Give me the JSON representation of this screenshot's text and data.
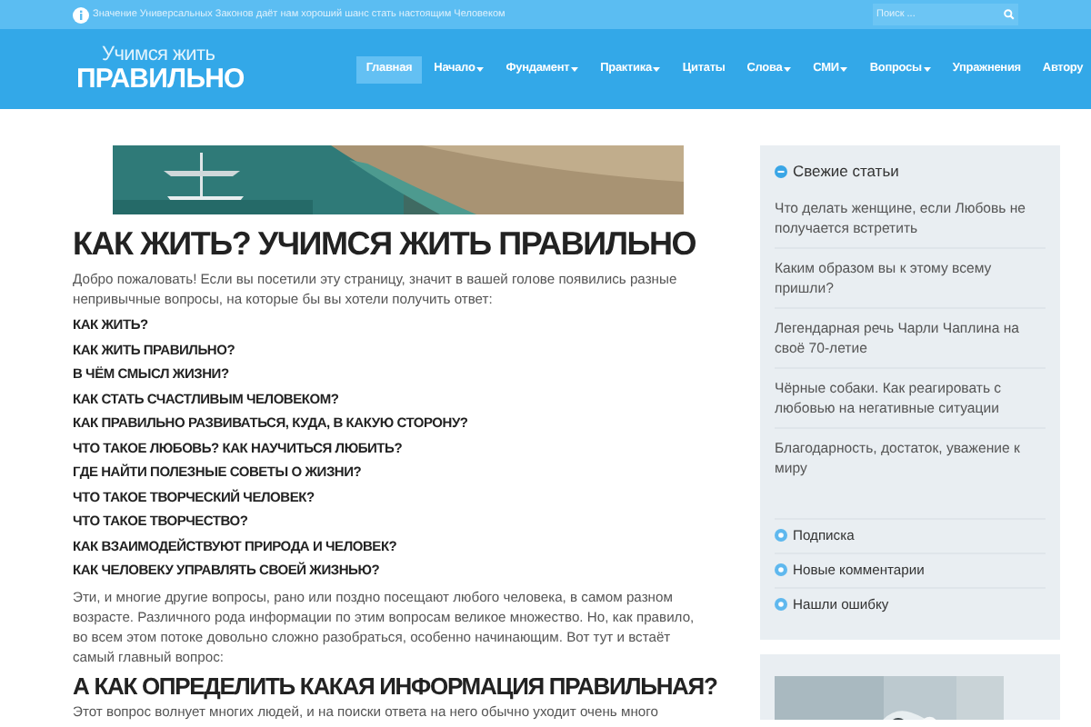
{
  "top_bar": {
    "notice": "Значение Универсальных Законов даёт нам хороший шанс стать настоящим Человеком",
    "search": {
      "placeholder": "Поиск ..."
    }
  },
  "logo": {
    "line_1": "Учимся жить",
    "line_2": "ПРАВИЛЬНО"
  },
  "nav": [
    {
      "label": "Главная",
      "selected": true,
      "dropdown": false
    },
    {
      "label": "Начало",
      "selected": false,
      "dropdown": true
    },
    {
      "label": "Фундамент",
      "selected": false,
      "dropdown": true
    },
    {
      "label": "Практика",
      "selected": false,
      "dropdown": true
    },
    {
      "label": "Цитаты",
      "selected": false,
      "dropdown": false
    },
    {
      "label": "Слова",
      "selected": false,
      "dropdown": true
    },
    {
      "label": "СМИ",
      "selected": false,
      "dropdown": true
    },
    {
      "label": "Вопросы",
      "selected": false,
      "dropdown": true
    },
    {
      "label": "Упражнения",
      "selected": false,
      "dropdown": false
    },
    {
      "label": "Автору",
      "selected": false,
      "dropdown": false
    }
  ],
  "main": {
    "title": "КАК ЖИТЬ? УЧИМСЯ ЖИТЬ ПРАВИЛЬНО",
    "intro": "Добро пожаловать! Если вы посетили эту страницу, значит в вашей голове появились разные непривычные вопросы, на которые бы вы хотели получить ответ:",
    "questions": [
      "КАК ЖИТЬ?",
      "КАК ЖИТЬ ПРАВИЛЬНО?",
      "В ЧЁМ СМЫСЛ ЖИЗНИ?",
      "КАК СТАТЬ СЧАСТЛИВЫМ ЧЕЛОВЕКОМ?",
      "КАК ПРАВИЛЬНО РАЗВИВАТЬСЯ, КУДА, В КАКУЮ СТОРОНУ?",
      "ЧТО ТАКОЕ ЛЮБОВЬ? КАК НАУЧИТЬСЯ ЛЮБИТЬ?",
      "ГДЕ НАЙТИ ПОЛЕЗНЫЕ СОВЕТЫ О ЖИЗНИ?",
      "ЧТО ТАКОЕ ТВОРЧЕСКИЙ ЧЕЛОВЕК?",
      "ЧТО ТАКОЕ ТВОРЧЕСТВО?",
      "КАК ВЗАИМОДЕЙСТВУЮТ ПРИРОДА И ЧЕЛОВЕК?",
      "КАК ЧЕЛОВЕКУ УПРАВЛЯТЬ СВОЕЙ ЖИЗНЬЮ?"
    ],
    "paragraph": "Эти, и многие другие вопросы, рано или поздно посещают любого человека, в самом разном возрасте. Различного рода информации по этим вопросам великое множество. Но, как правило, во всем этом потоке довольно сложно разобраться, особенно начинающим. Вот тут и встаёт самый главный вопрос:",
    "subtitle": "А КАК ОПРЕДЕЛИТЬ КАКАЯ ИНФОРМАЦИЯ ПРАВИЛЬНАЯ?",
    "last_line": "Этот вопрос волнует многих людей, и на поиски ответа на него обычно уходит очень много"
  },
  "sidebar": {
    "recent": {
      "title": "Свежие статьи",
      "expanded": true,
      "items": [
        "Что делать женщине, если Любовь не получается встретить",
        "Каким образом вы к этому всему пришли?",
        "Легендарная речь Чарли Чаплина на своё 70-летие",
        "Чёрные собаки. Как реагировать с любовью на негативные ситуации",
        "Благодарность, достаток, уважение к миру"
      ]
    },
    "links": [
      {
        "label": "Подписка",
        "expanded": false
      },
      {
        "label": "Новые комментарии",
        "expanded": false
      },
      {
        "label": "Нашли ошибку",
        "expanded": false
      }
    ]
  }
}
